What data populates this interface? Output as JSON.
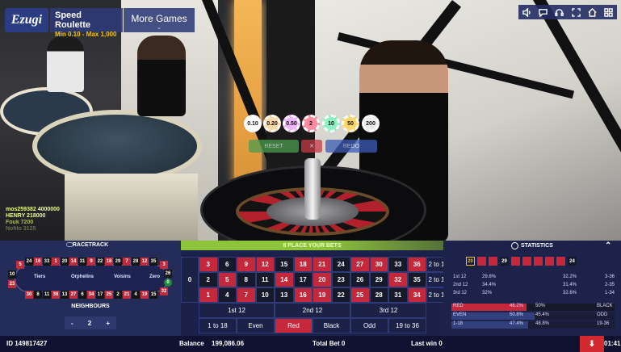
{
  "header": {
    "logo": "Ezugi",
    "game_title": "Speed Roulette",
    "limits": "Min 0.10 - Max 1,000",
    "more_games": "More Games",
    "icons": [
      "sound-icon",
      "chat-icon",
      "support-icon",
      "fullscreen-icon",
      "home-icon",
      "menu-icon"
    ]
  },
  "video": {
    "chips": [
      "0.10",
      "0.20",
      "0.50",
      "2",
      "10",
      "50",
      "200"
    ],
    "chip_colors": [
      "#ffffff",
      "#ffd9a8",
      "#f1b4ff",
      "#ff8aa0",
      "#8df0c0",
      "#ffd66a",
      "#eeeeee"
    ],
    "players": [
      "mos259382 4000000",
      "HENRY 218000",
      "Fouk 7200",
      "Nofilo 3125"
    ],
    "ghost_buttons": {
      "reset": "RESET",
      "redo": "REDO"
    }
  },
  "racetrack": {
    "title": "RACETRACK",
    "top_row": [
      "24",
      "16",
      "33",
      "1",
      "20",
      "14",
      "31",
      "9",
      "22",
      "18",
      "29",
      "7",
      "28",
      "12",
      "35"
    ],
    "bottom_row": [
      "30",
      "8",
      "11",
      "36",
      "13",
      "27",
      "6",
      "34",
      "17",
      "25",
      "2",
      "21",
      "4",
      "19",
      "15"
    ],
    "left_col": [
      "5",
      "10",
      "23"
    ],
    "right_col": [
      "3",
      "26",
      "0",
      "32"
    ],
    "sections": [
      "Tiers",
      "Orphelins",
      "Voisins",
      "Zero"
    ],
    "neighbours_label": "NEIGHBOURS",
    "neighbours_minus": "-",
    "neighbours_value": "2",
    "neighbours_plus": "+"
  },
  "banner": "8 PLACE YOUR BETS",
  "board": {
    "zero": "0",
    "rows": [
      [
        "3",
        "6",
        "9",
        "12",
        "15",
        "18",
        "21",
        "24",
        "27",
        "30",
        "33",
        "36"
      ],
      [
        "2",
        "5",
        "8",
        "11",
        "14",
        "17",
        "20",
        "23",
        "26",
        "29",
        "32",
        "35"
      ],
      [
        "1",
        "4",
        "7",
        "10",
        "13",
        "16",
        "19",
        "22",
        "25",
        "28",
        "31",
        "34"
      ]
    ],
    "row_colors": [
      [
        "r",
        "b",
        "r",
        "r",
        "b",
        "r",
        "r",
        "b",
        "r",
        "r",
        "b",
        "r"
      ],
      [
        "b",
        "r",
        "b",
        "b",
        "r",
        "b",
        "r",
        "b",
        "b",
        "b",
        "r",
        "b"
      ],
      [
        "r",
        "b",
        "r",
        "b",
        "b",
        "r",
        "r",
        "b",
        "r",
        "b",
        "b",
        "r"
      ]
    ],
    "columns": [
      "2 to 1",
      "2 to 1",
      "2 to 1"
    ],
    "dozens": [
      "1st 12",
      "2nd 12",
      "3rd 12"
    ],
    "even_bets": [
      "1 to 18",
      "Even",
      "Red",
      "Black",
      "Odd",
      "19 to 36"
    ]
  },
  "statistics": {
    "title": "STATISTICS",
    "history": [
      "20",
      "",
      "",
      "29",
      "",
      "",
      "",
      "",
      "",
      "24"
    ],
    "dozen_stats": [
      {
        "left": "1st 12",
        "pct": "29.8%",
        "right_pct": "32.2%",
        "right": "3-36"
      },
      {
        "left": "2nd 12",
        "pct": "34.4%",
        "right_pct": "31.4%",
        "right": "2-35"
      },
      {
        "left": "3rd 12",
        "pct": "32%",
        "right_pct": "32.6%",
        "right": "1-34"
      }
    ],
    "red_black": {
      "left": "RED",
      "left_pct": "46.2%",
      "right_pct": "50%",
      "right": "BLACK"
    },
    "even_odd": {
      "left": "EVEN",
      "left_pct": "50.8%",
      "right_pct": "45.4%",
      "right": "ODD"
    },
    "low_high": {
      "left": "1-18",
      "left_pct": "47.4%",
      "right_pct": "48.8%",
      "right": "19-36"
    }
  },
  "footer": {
    "id": "ID 149817427",
    "balance_label": "Balance",
    "balance": "199,086.06",
    "total_bet": "Total Bet 0",
    "last_win": "Last win 0",
    "time": "01:41"
  }
}
